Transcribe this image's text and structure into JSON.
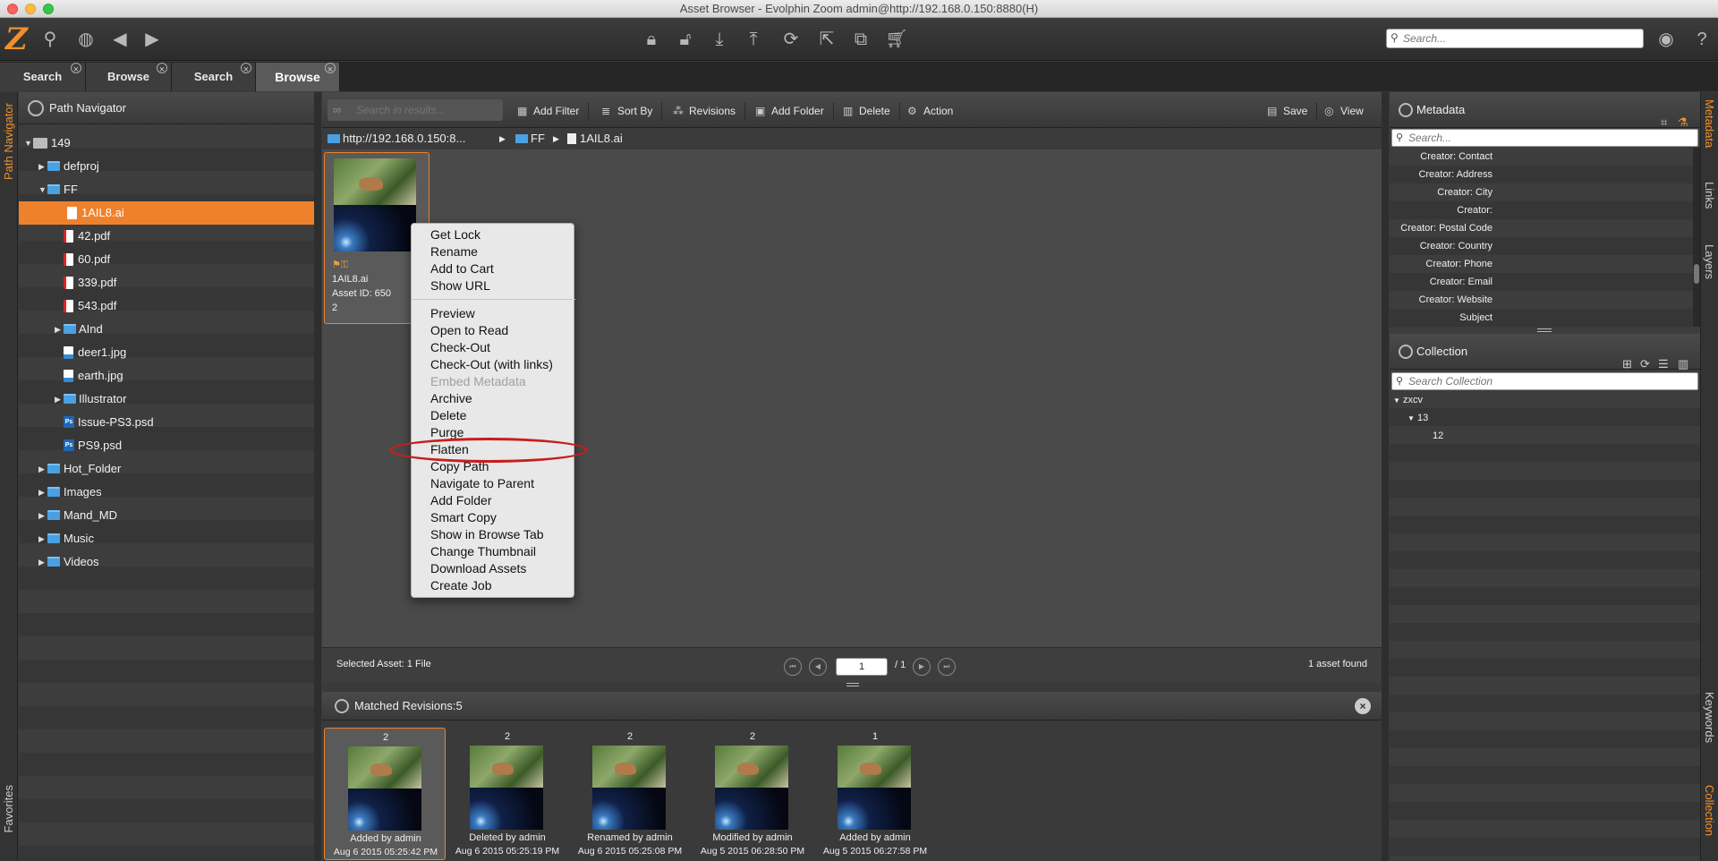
{
  "window": {
    "title": "Asset Browser - Evolphin Zoom admin@http://192.168.0.150:8880(H)"
  },
  "toolbar": {
    "logo": "Z",
    "global_search_placeholder": "Search..."
  },
  "tabs": [
    {
      "label": "Search"
    },
    {
      "label": "Browse"
    },
    {
      "label": "Search"
    },
    {
      "label": "Browse"
    }
  ],
  "left_rail": {
    "path_navigator": "Path Navigator",
    "favorites": "Favorites"
  },
  "path_navigator": {
    "title": "Path Navigator",
    "tree": [
      {
        "label": "149"
      },
      {
        "label": "defproj"
      },
      {
        "label": "FF"
      },
      {
        "label": "1AIL8.ai"
      },
      {
        "label": "42.pdf"
      },
      {
        "label": "60.pdf"
      },
      {
        "label": "339.pdf"
      },
      {
        "label": "543.pdf"
      },
      {
        "label": "AInd"
      },
      {
        "label": "deer1.jpg"
      },
      {
        "label": "earth.jpg"
      },
      {
        "label": "Illustrator"
      },
      {
        "label": "Issue-PS3.psd"
      },
      {
        "label": "PS9.psd"
      },
      {
        "label": "Hot_Folder"
      },
      {
        "label": "Images"
      },
      {
        "label": "Mand_MD"
      },
      {
        "label": "Music"
      },
      {
        "label": "Videos"
      }
    ]
  },
  "center_toolbar": {
    "search_placeholder": "Search in results...",
    "add_filter": "Add Filter",
    "sort_by": "Sort By",
    "revisions": "Revisions",
    "add_folder": "Add Folder",
    "delete": "Delete",
    "action": "Action",
    "save": "Save",
    "view": "View"
  },
  "breadcrumb": {
    "server": "http://192.168.0.150:8...",
    "folder": "FF",
    "file": "1AIL8.ai"
  },
  "asset": {
    "name": "1AIL8.ai",
    "asset_id": "Asset ID: 650",
    "revision": "2"
  },
  "context_menu": {
    "items": [
      {
        "label": "Get Lock"
      },
      {
        "label": "Rename"
      },
      {
        "label": "Add to Cart"
      },
      {
        "label": "Show URL"
      },
      {
        "label": "Preview"
      },
      {
        "label": "Open to Read"
      },
      {
        "label": "Check-Out"
      },
      {
        "label": "Check-Out (with links)"
      },
      {
        "label": "Embed Metadata",
        "disabled": true
      },
      {
        "label": "Archive"
      },
      {
        "label": "Delete"
      },
      {
        "label": "Purge"
      },
      {
        "label": "Flatten",
        "highlighted": true
      },
      {
        "label": "Copy Path"
      },
      {
        "label": "Navigate to Parent"
      },
      {
        "label": "Add Folder"
      },
      {
        "label": "Smart Copy"
      },
      {
        "label": "Show in Browse Tab"
      },
      {
        "label": "Change Thumbnail"
      },
      {
        "label": "Download Assets"
      },
      {
        "label": "Create Job"
      }
    ]
  },
  "status": {
    "selected": "Selected Asset: 1 File",
    "page": "1",
    "total_pages": "/ 1",
    "found": "1 asset found"
  },
  "revisions": {
    "title": "Matched Revisions:5",
    "items": [
      {
        "num": "2",
        "action": "Added by admin",
        "date": "Aug 6 2015 05:25:42 PM"
      },
      {
        "num": "2",
        "action": "Deleted by admin",
        "date": "Aug 6 2015 05:25:19 PM"
      },
      {
        "num": "2",
        "action": "Renamed by admin",
        "date": "Aug 6 2015 05:25:08 PM"
      },
      {
        "num": "2",
        "action": "Modified by admin",
        "date": "Aug 5 2015 06:28:50 PM"
      },
      {
        "num": "1",
        "action": "Added by admin",
        "date": "Aug 5 2015 06:27:58 PM"
      }
    ]
  },
  "metadata": {
    "title": "Metadata",
    "search_placeholder": "Search...",
    "fields": [
      {
        "key": "Creator: Contact"
      },
      {
        "key": "Creator: Address"
      },
      {
        "key": "Creator: City"
      },
      {
        "key": "Creator:"
      },
      {
        "key": "Creator: Postal Code"
      },
      {
        "key": "Creator: Country"
      },
      {
        "key": "Creator: Phone"
      },
      {
        "key": "Creator: Email"
      },
      {
        "key": "Creator: Website"
      },
      {
        "key": "Subject"
      }
    ]
  },
  "collection": {
    "title": "Collection",
    "search_placeholder": "Search Collection",
    "tree": [
      {
        "label": "zxcv"
      },
      {
        "label": "13"
      },
      {
        "label": "12"
      }
    ]
  },
  "right_rail": {
    "metadata": "Metadata",
    "links": "Links",
    "layers": "Layers",
    "keywords": "Keywords",
    "collection": "Collection"
  }
}
